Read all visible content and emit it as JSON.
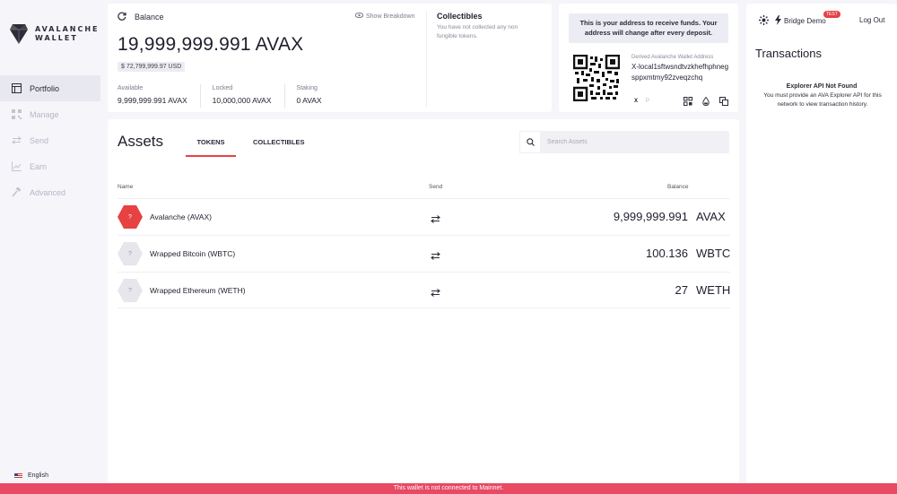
{
  "brand": {
    "line1": "AVALANCHE",
    "line2": "WALLET"
  },
  "sidebar": {
    "items": [
      {
        "label": "Portfolio",
        "icon": "portfolio-icon",
        "active": true
      },
      {
        "label": "Manage",
        "icon": "qr-grid-icon",
        "active": false
      },
      {
        "label": "Send",
        "icon": "transfer-icon",
        "active": false
      },
      {
        "label": "Earn",
        "icon": "chart-icon",
        "active": false
      },
      {
        "label": "Advanced",
        "icon": "hammer-icon",
        "active": false
      }
    ],
    "language": "English"
  },
  "balance": {
    "label": "Balance",
    "show_breakdown": "Show Breakdown",
    "total": "19,999,999.991 AVAX",
    "usd": "$ 72,799,999.97 USD",
    "available_label": "Available",
    "available_value": "9,999,999.991 AVAX",
    "locked_label": "Locked",
    "locked_value": "10,000,000 AVAX",
    "staking_label": "Staking",
    "staking_value": "0 AVAX"
  },
  "collectibles_summary": {
    "title": "Collectibles",
    "text": "You have not collected any non fungible tokens."
  },
  "address": {
    "notice": "This is your address to receive funds. Your address will change after every deposit.",
    "label": "Derived Avalanche Wallet Address",
    "value": "X-local1sftwsndtvzkhefhphnegsppxmtmy92zveqzchq",
    "chain_x": "X",
    "chain_p": "P"
  },
  "header": {
    "network": "Bridge Demo",
    "badge": "TEST",
    "logout": "Log Out"
  },
  "transactions": {
    "title": "Transactions",
    "error_title": "Explorer API Not Found",
    "error_message": "You must provide an AVA Explorer API for this network to view transaction history."
  },
  "assets": {
    "title": "Assets",
    "tabs": [
      "TOKENS",
      "COLLECTIBLES"
    ],
    "search_placeholder": "Search Assets",
    "columns": {
      "name": "Name",
      "send": "Send",
      "balance": "Balance"
    },
    "rows": [
      {
        "name": "Avalanche (AVAX)",
        "amount": "9,999,999.991",
        "symbol": "AVAX",
        "icon_label": "?"
      },
      {
        "name": "Wrapped Bitcoin (WBTC)",
        "amount": "100.136",
        "symbol": "WBTC",
        "icon_label": "?"
      },
      {
        "name": "Wrapped Ethereum (WETH)",
        "amount": "27",
        "symbol": "WETH",
        "icon_label": "?"
      }
    ]
  },
  "footer": {
    "banner": "This wallet is not connected to Mainnet."
  },
  "colors": {
    "accent": "#e84142",
    "banner": "#e84963",
    "background": "#f5f5fa"
  }
}
